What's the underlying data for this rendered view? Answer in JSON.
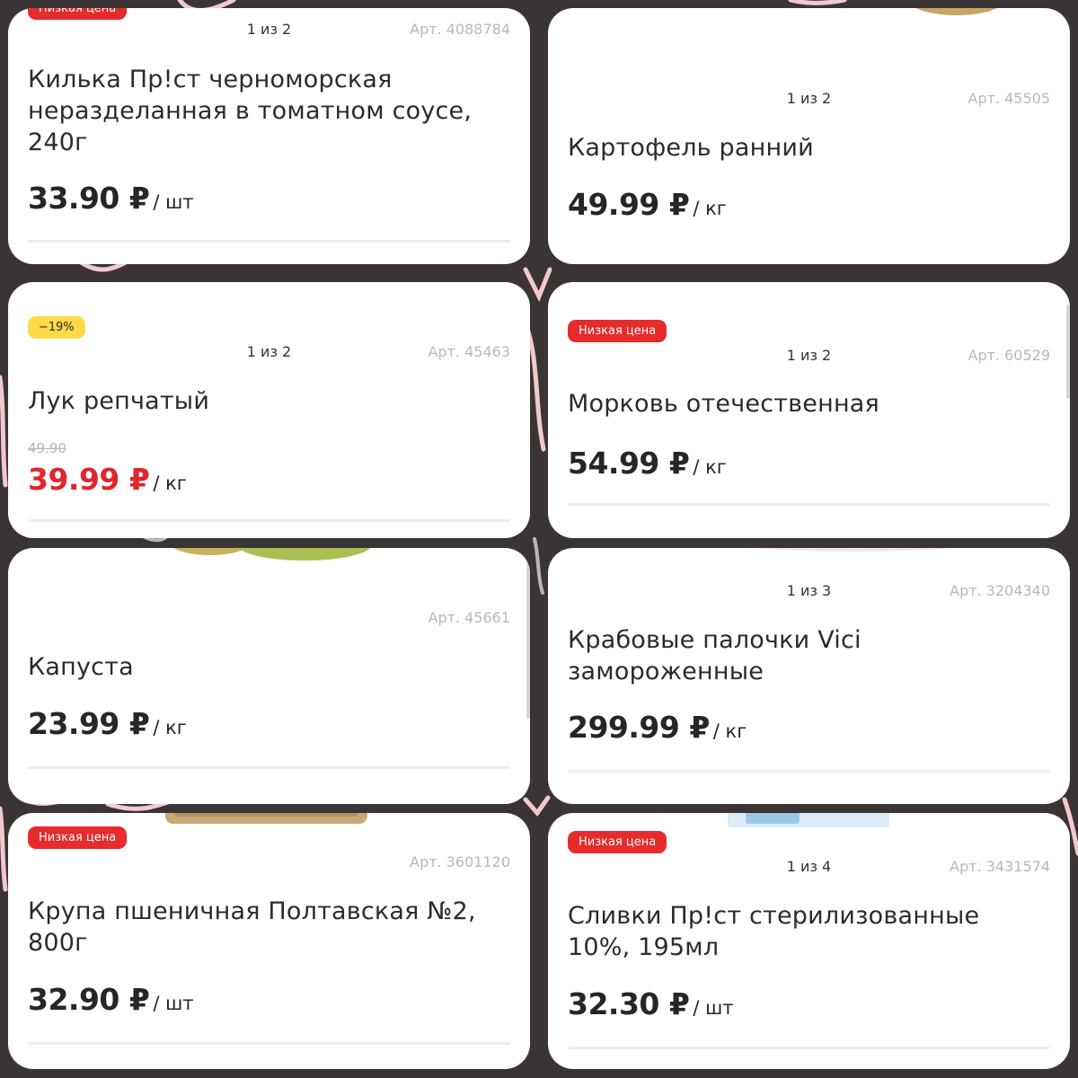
{
  "products": [
    {
      "badge": "Низкая цена",
      "counter": "1 из 2",
      "article": "Арт. 4088784",
      "title": "Килька Пр!ст черноморская неразделанная в томатном соусе, 240г",
      "price": "33.90 ₽",
      "unit": "/ шт"
    },
    {
      "counter": "1 из 2",
      "article": "Арт. 45505",
      "title": "Картофель ранний",
      "price": "49.99 ₽",
      "unit": "/ кг"
    },
    {
      "badge": "−19%",
      "counter": "1 из 2",
      "article": "Арт. 45463",
      "title": "Лук репчатый",
      "old_price": "49.90",
      "price": "39.99 ₽",
      "unit": "/ кг"
    },
    {
      "badge": "Низкая цена",
      "counter": "1 из 2",
      "article": "Арт. 60529",
      "title": "Морковь отечественная",
      "price": "54.99 ₽",
      "unit": "/ кг"
    },
    {
      "article": "Арт. 45661",
      "title": "Капуста",
      "price": "23.99 ₽",
      "unit": "/ кг"
    },
    {
      "counter": "1 из 3",
      "article": "Арт. 3204340",
      "title": "Крабовые палочки Vici замороженные",
      "price": "299.99 ₽",
      "unit": "/ кг"
    },
    {
      "badge": "Низкая цена",
      "article": "Арт. 3601120",
      "title": "Крупа пшеничная Полтавская №2, 800г",
      "price": "32.90 ₽",
      "unit": "/ шт"
    },
    {
      "badge": "Низкая цена",
      "counter": "1 из 4",
      "article": "Арт. 3431574",
      "title": "Сливки Пр!ст стерилизованные 10%, 195мл",
      "price": "32.30 ₽",
      "unit": "/ шт"
    }
  ],
  "colors": {
    "background": "#3a3534",
    "accent_red": "#e52b2b",
    "discount_yellow": "#ffd94a",
    "scribble_pink": "#f2c9cf"
  }
}
